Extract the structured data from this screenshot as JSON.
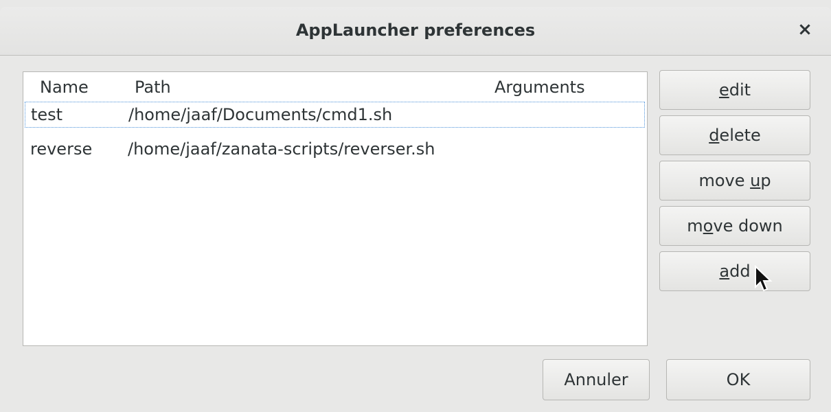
{
  "window": {
    "title": "AppLauncher preferences",
    "close_label": "×"
  },
  "list": {
    "columns": [
      "Name",
      "Path",
      "Arguments"
    ],
    "rows": [
      {
        "name": "test",
        "path": "/home/jaaf/Documents/cmd1.sh",
        "arguments": ""
      },
      {
        "name": "reverse",
        "path": "/home/jaaf/zanata-scripts/reverser.sh",
        "arguments": ""
      }
    ]
  },
  "buttons": {
    "edit": {
      "pre": "",
      "mnemonic": "e",
      "post": "dit"
    },
    "delete": {
      "pre": "",
      "mnemonic": "d",
      "post": "elete"
    },
    "move_up": {
      "pre": "move ",
      "mnemonic": "u",
      "post": "p"
    },
    "move_down": {
      "pre": "m",
      "mnemonic": "o",
      "post": "ve down"
    },
    "add": {
      "pre": "",
      "mnemonic": "a",
      "post": "dd"
    }
  },
  "footer": {
    "cancel_label": "Annuler",
    "ok_label": "OK"
  }
}
